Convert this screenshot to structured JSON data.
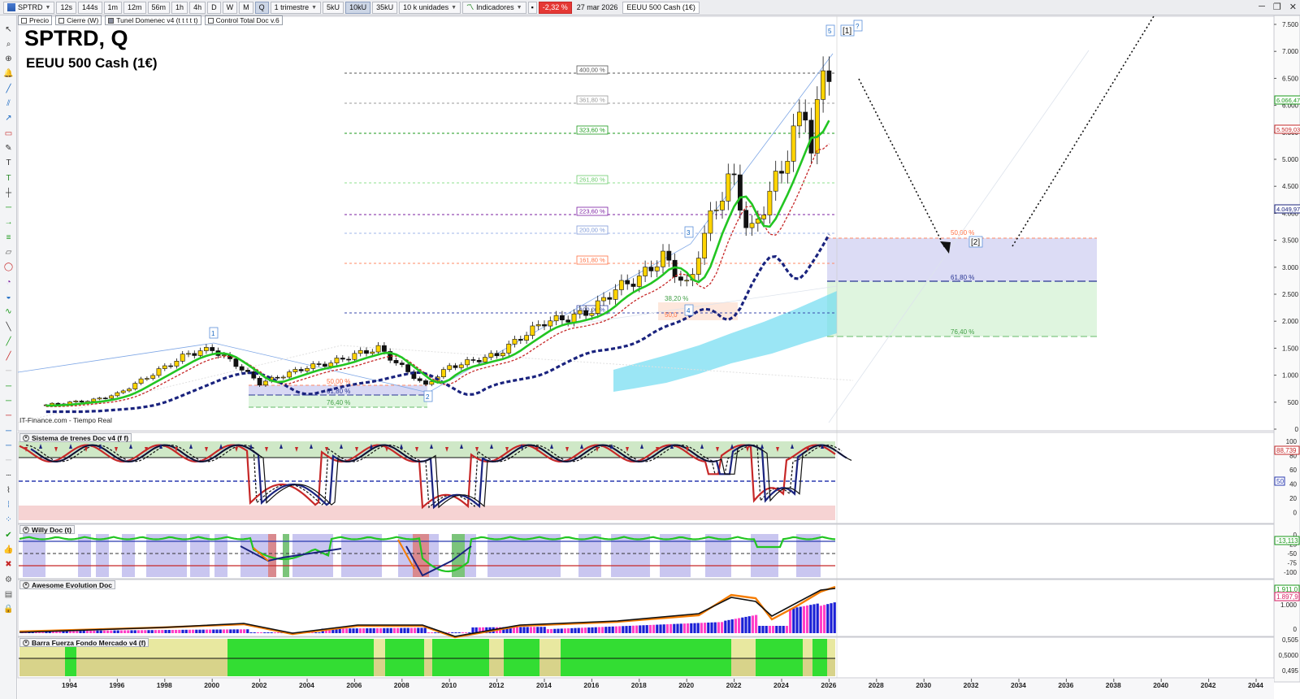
{
  "toolbar": {
    "symbol": "SPTRD",
    "timeframes": [
      "12s",
      "144s",
      "1m",
      "12m",
      "56m",
      "1h",
      "4h",
      "D",
      "W",
      "M",
      "Q"
    ],
    "period": "1 trimestre",
    "units": [
      "5kU",
      "10kU",
      "35kU"
    ],
    "unit_select": "10 k unidades",
    "indicators_label": "Indicadores",
    "change_pct": "-2,32 %",
    "date": "27 mar 2026",
    "instrument_badge": "EEUU 500 Cash (1€)"
  },
  "legend": {
    "items": [
      "Precio",
      "Cierre (W)",
      "Tunel Domenec v4 (t t t t t)",
      "Control Total Doc v.6"
    ]
  },
  "chart": {
    "title": "SPTRD, Q",
    "subtitle": "EEUU 500 Cash (1€)",
    "credit": "IT-Finance.com - Tiempo Real",
    "wave_labels": [
      "1",
      "2",
      "3",
      "4",
      "5",
      "[1]",
      "?",
      "[2]"
    ],
    "fib_main": [
      "400,00 %",
      "361,80 %",
      "323,60 %",
      "261,80 %",
      "223,60 %",
      "200,00 %",
      "161,80 %",
      "100,00 %"
    ],
    "fib_small": [
      "50,00 %",
      "61,80 %",
      "76,40 %"
    ],
    "fib_mid": [
      "38,20 %",
      "50,0"
    ],
    "fib_projection": [
      "50,00 %",
      "61,80 %",
      "76,40 %"
    ],
    "y_ticks": [
      "7.500",
      "7.000",
      "6.500",
      "6.000",
      "5.500",
      "5.000",
      "4.500",
      "4.000",
      "3.500",
      "3.000",
      "2.500",
      "2.000",
      "1.500",
      "1.000",
      "500",
      "0"
    ],
    "price_badges": [
      {
        "text": "6.066,47",
        "color": "#1a9a1a"
      },
      {
        "text": "5.509,03",
        "color": "#c62828"
      },
      {
        "text": "4.049,97",
        "color": "#1a237e"
      }
    ]
  },
  "panels": {
    "trenes": {
      "title": "Sistema de trenes Doc v4 (f f)",
      "y_ticks": [
        "100",
        "80",
        "60",
        "40",
        "20",
        "0"
      ],
      "badge": "88,739",
      "level": "50"
    },
    "willy": {
      "title": "Willy Doc (t)",
      "y_ticks": [
        "0",
        "-25",
        "-50",
        "-75",
        "-100"
      ],
      "badge": "-13,113"
    },
    "awesome": {
      "title": "Awesome Evolution Doc",
      "y_ticks": [
        "1.000",
        "0"
      ],
      "badge_top": "1.911,0",
      "badge": "1.897,9"
    },
    "barra": {
      "title": "Barra Fuerza Fondo Mercado v4 (f)",
      "y_ticks": [
        "0,505",
        "0,5000",
        "0,495"
      ]
    }
  },
  "x_axis": [
    "1994",
    "1996",
    "1998",
    "2000",
    "2002",
    "2004",
    "2006",
    "2008",
    "2010",
    "2012",
    "2014",
    "2016",
    "2018",
    "2020",
    "2022",
    "2024",
    "2026",
    "2028",
    "2030",
    "2032",
    "2034",
    "2036",
    "2038",
    "2040",
    "2042",
    "2044"
  ],
  "colors": {
    "fast_ma": "#22c522",
    "slow_ma": "#c62828",
    "long_ma": "#1a237e",
    "bull_candle": "#ffd400",
    "projection_zone": "#d8d8f4",
    "green_zone": "#dff5df",
    "cyan_band": "#66d9f0"
  }
}
